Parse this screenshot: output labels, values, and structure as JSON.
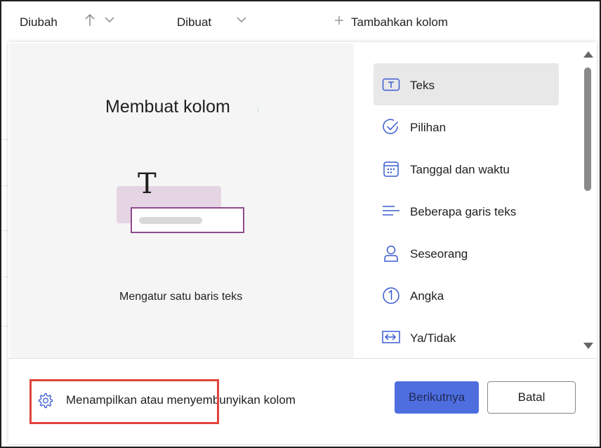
{
  "header": {
    "col_modified": "Diubah",
    "col_created": "Dibuat",
    "add_column": "Tambahkan kolom"
  },
  "preview": {
    "title": "Membuat kolom",
    "caption": "Mengatur satu baris teks",
    "illustration_letter": "T"
  },
  "column_types": [
    {
      "label": "Teks",
      "icon": "text-box-icon",
      "selected": true
    },
    {
      "label": "Pilihan",
      "icon": "checkmark-circle-icon",
      "selected": false
    },
    {
      "label": "Tanggal dan waktu",
      "icon": "calendar-icon",
      "selected": false
    },
    {
      "label": "Beberapa garis teks",
      "icon": "multiline-text-icon",
      "selected": false
    },
    {
      "label": "Seseorang",
      "icon": "person-icon",
      "selected": false
    },
    {
      "label": "Angka",
      "icon": "number-circle-icon",
      "selected": false
    },
    {
      "label": "Ya/Tidak",
      "icon": "yes-no-toggle-icon",
      "selected": false
    }
  ],
  "footer": {
    "show_hide_label": "Menampilkan atau menyembunyikan kolom",
    "next_label": "Berikutnya",
    "cancel_label": "Batal"
  },
  "colors": {
    "accent": "#4e6ee0",
    "illustration_purple": "#8e4b8c",
    "highlight_red": "#e0433b"
  }
}
